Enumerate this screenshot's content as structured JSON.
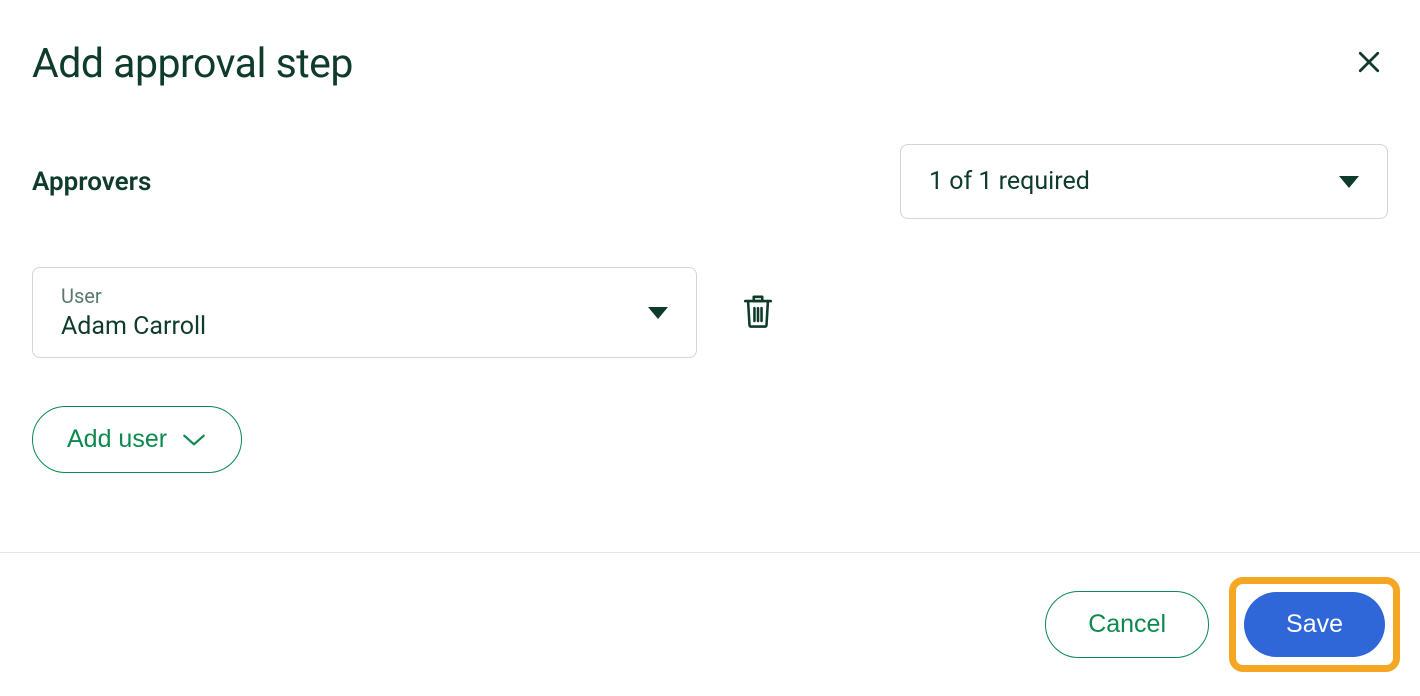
{
  "modal": {
    "title": "Add approval step"
  },
  "approvers": {
    "section_label": "Approvers",
    "required_text": "1 of 1 required"
  },
  "user_select": {
    "label": "User",
    "value": "Adam Carroll"
  },
  "buttons": {
    "add_user": "Add user",
    "cancel": "Cancel",
    "save": "Save"
  }
}
